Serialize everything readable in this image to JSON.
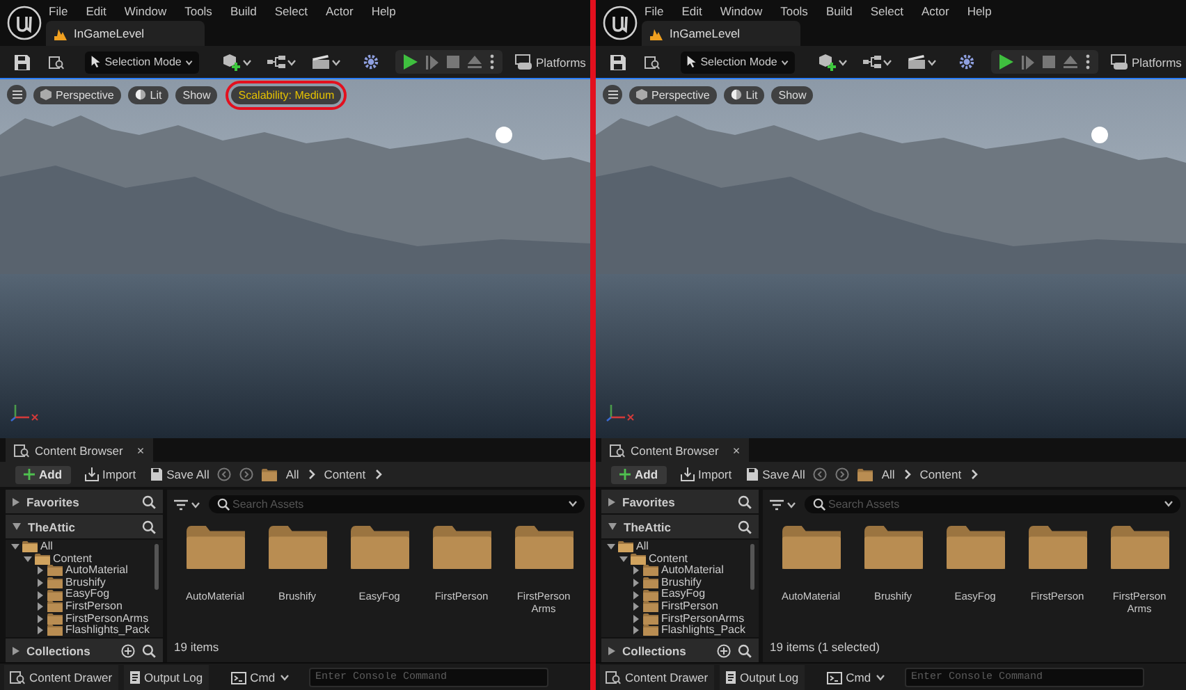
{
  "editors": [
    {
      "menu": [
        "File",
        "Edit",
        "Window",
        "Tools",
        "Build",
        "Select",
        "Actor",
        "Help"
      ],
      "level_tab": "InGameLevel",
      "selection_mode": "Selection Mode",
      "platforms": "Platforms",
      "viewport": {
        "buttons": [
          {
            "kind": "perspective",
            "label": "Perspective"
          },
          {
            "kind": "lit",
            "label": "Lit"
          },
          {
            "kind": "show",
            "label": "Show"
          }
        ],
        "scalability": {
          "label": "Scalability: Medium",
          "highlighted": true
        }
      },
      "content_browser": {
        "tab": "Content Browser",
        "close": "×",
        "add": "Add",
        "import": "Import",
        "save_all": "Save All",
        "breadcrumb": [
          "All",
          "Content"
        ],
        "favorites": "Favorites",
        "source": "TheAttic",
        "collections": "Collections",
        "tree": [
          {
            "label": "All",
            "expanded": true,
            "children": [
              {
                "label": "Content",
                "expanded": true,
                "children": [
                  {
                    "label": "AutoMaterial",
                    "expanded": false
                  },
                  {
                    "label": "Brushify",
                    "expanded": false
                  },
                  {
                    "label": "EasyFog",
                    "expanded": false
                  },
                  {
                    "label": "FirstPerson",
                    "expanded": false
                  },
                  {
                    "label": "FirstPersonArms",
                    "expanded": false
                  },
                  {
                    "label": "Flashlights_Pack",
                    "expanded": false
                  }
                ]
              }
            ]
          }
        ],
        "search": {
          "placeholder": "Search Assets"
        },
        "folders": [
          "AutoMaterial",
          "Brushify",
          "EasyFog",
          "FirstPerson",
          "FirstPerson Arms"
        ],
        "status": "19 items"
      },
      "bottom_bar": {
        "content_drawer": "Content Drawer",
        "output_log": "Output Log",
        "cmd": "Cmd",
        "console": {
          "placeholder": "Enter Console Command"
        }
      }
    },
    {
      "menu": [
        "File",
        "Edit",
        "Window",
        "Tools",
        "Build",
        "Select",
        "Actor",
        "Help"
      ],
      "level_tab": "InGameLevel",
      "selection_mode": "Selection Mode",
      "platforms": "Platforms",
      "viewport": {
        "buttons": [
          {
            "kind": "perspective",
            "label": "Perspective"
          },
          {
            "kind": "lit",
            "label": "Lit"
          },
          {
            "kind": "show",
            "label": "Show"
          }
        ]
      },
      "content_browser": {
        "tab": "Content Browser",
        "close": "×",
        "add": "Add",
        "import": "Import",
        "save_all": "Save All",
        "breadcrumb": [
          "All",
          "Content"
        ],
        "favorites": "Favorites",
        "source": "TheAttic",
        "collections": "Collections",
        "tree": [
          {
            "label": "All",
            "expanded": true,
            "children": [
              {
                "label": "Content",
                "expanded": true,
                "children": [
                  {
                    "label": "AutoMaterial",
                    "expanded": false
                  },
                  {
                    "label": "Brushify",
                    "expanded": false
                  },
                  {
                    "label": "EasyFog",
                    "expanded": false
                  },
                  {
                    "label": "FirstPerson",
                    "expanded": false
                  },
                  {
                    "label": "FirstPersonArms",
                    "expanded": false
                  },
                  {
                    "label": "Flashlights_Pack",
                    "expanded": false
                  }
                ]
              }
            ]
          }
        ],
        "search": {
          "placeholder": "Search Assets"
        },
        "folders": [
          "AutoMaterial",
          "Brushify",
          "EasyFog",
          "FirstPerson",
          "FirstPerson Arms"
        ],
        "status": "19 items (1 selected)"
      },
      "bottom_bar": {
        "content_drawer": "Content Drawer",
        "output_log": "Output Log",
        "cmd": "Cmd",
        "console": {
          "placeholder": "Enter Console Command"
        }
      }
    }
  ]
}
